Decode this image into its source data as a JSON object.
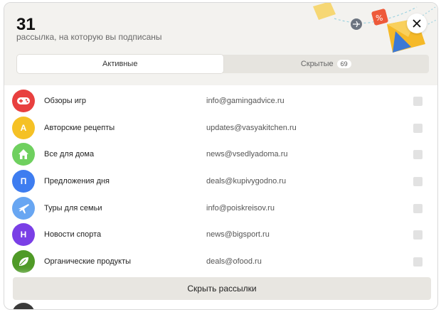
{
  "header": {
    "count": "31",
    "subtitle": "рассылка, на которую вы подписаны"
  },
  "tabs": [
    {
      "label": "Активные",
      "active": true
    },
    {
      "label": "Скрытые",
      "badge": "69",
      "active": false
    }
  ],
  "subscriptions": [
    {
      "name": "Обзоры игр",
      "email": "info@gamingadvice.ru",
      "color": "#e8403f",
      "icon": "gamepad-icon",
      "letter": ""
    },
    {
      "name": "Авторские рецепты",
      "email": "updates@vasyakitchen.ru",
      "color": "#f5c125",
      "icon": "letter-avatar",
      "letter": "A"
    },
    {
      "name": "Все для дома",
      "email": "news@vsedlyadoma.ru",
      "color": "#6fd05f",
      "icon": "house-icon",
      "letter": ""
    },
    {
      "name": "Предложения дня",
      "email": "deals@kupivygodno.ru",
      "color": "#3e7df0",
      "icon": "letter-avatar",
      "letter": "П"
    },
    {
      "name": "Туры для семьи",
      "email": "info@poiskreisov.ru",
      "color": "#68a6f2",
      "icon": "airplane-icon",
      "letter": ""
    },
    {
      "name": "Новости спорта",
      "email": "news@bigsport.ru",
      "color": "#7a3fe6",
      "icon": "letter-avatar",
      "letter": "Н"
    },
    {
      "name": "Органические продукты",
      "email": "deals@ofood.ru",
      "color": "#4f9a27",
      "icon": "leaf-icon",
      "letter": ""
    }
  ],
  "footer": {
    "hide_button": "Скрыть рассылки"
  },
  "colors": {
    "header_bg": "#f3f2ef",
    "checkbox": "#e2e2e2",
    "button_bg": "#e8e6e1"
  }
}
